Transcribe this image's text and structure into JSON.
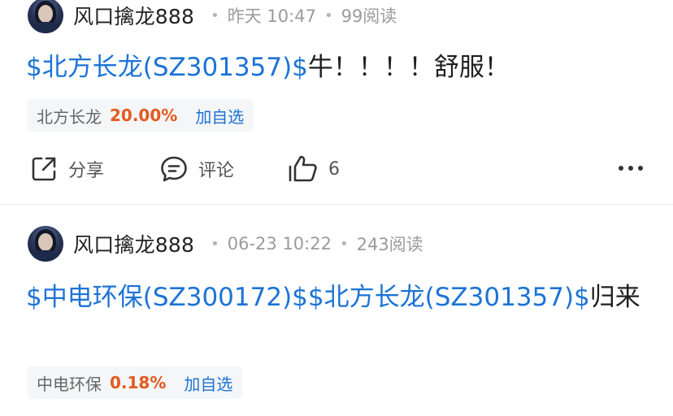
{
  "posts": [
    {
      "author": "风口擒龙888",
      "time": "昨天 10:47",
      "views": "99阅读",
      "content": [
        {
          "text": "$北方长龙(SZ301357)$",
          "tag": true
        },
        {
          "text": "牛！！！！舒服！",
          "tag": false
        }
      ],
      "chips": [
        {
          "name": "北方长龙",
          "pct": "20.00%",
          "add": "加自选"
        }
      ],
      "actions": {
        "share": "分享",
        "comment": "评论",
        "like_count": "6"
      }
    },
    {
      "author": "风口擒龙888",
      "time": "06-23 10:22",
      "views": "243阅读",
      "content": [
        {
          "text": "$中电环保(SZ300172)$",
          "tag": true
        },
        {
          "text": "$北方长龙(SZ301357)$",
          "tag": true
        },
        {
          "text": "归来",
          "tag": false
        }
      ],
      "chips": [
        {
          "name": "中电环保",
          "pct": "0.18%",
          "add": "加自选"
        }
      ]
    }
  ],
  "colors": {
    "link": "#1c73d6",
    "up": "#e25a1f"
  }
}
